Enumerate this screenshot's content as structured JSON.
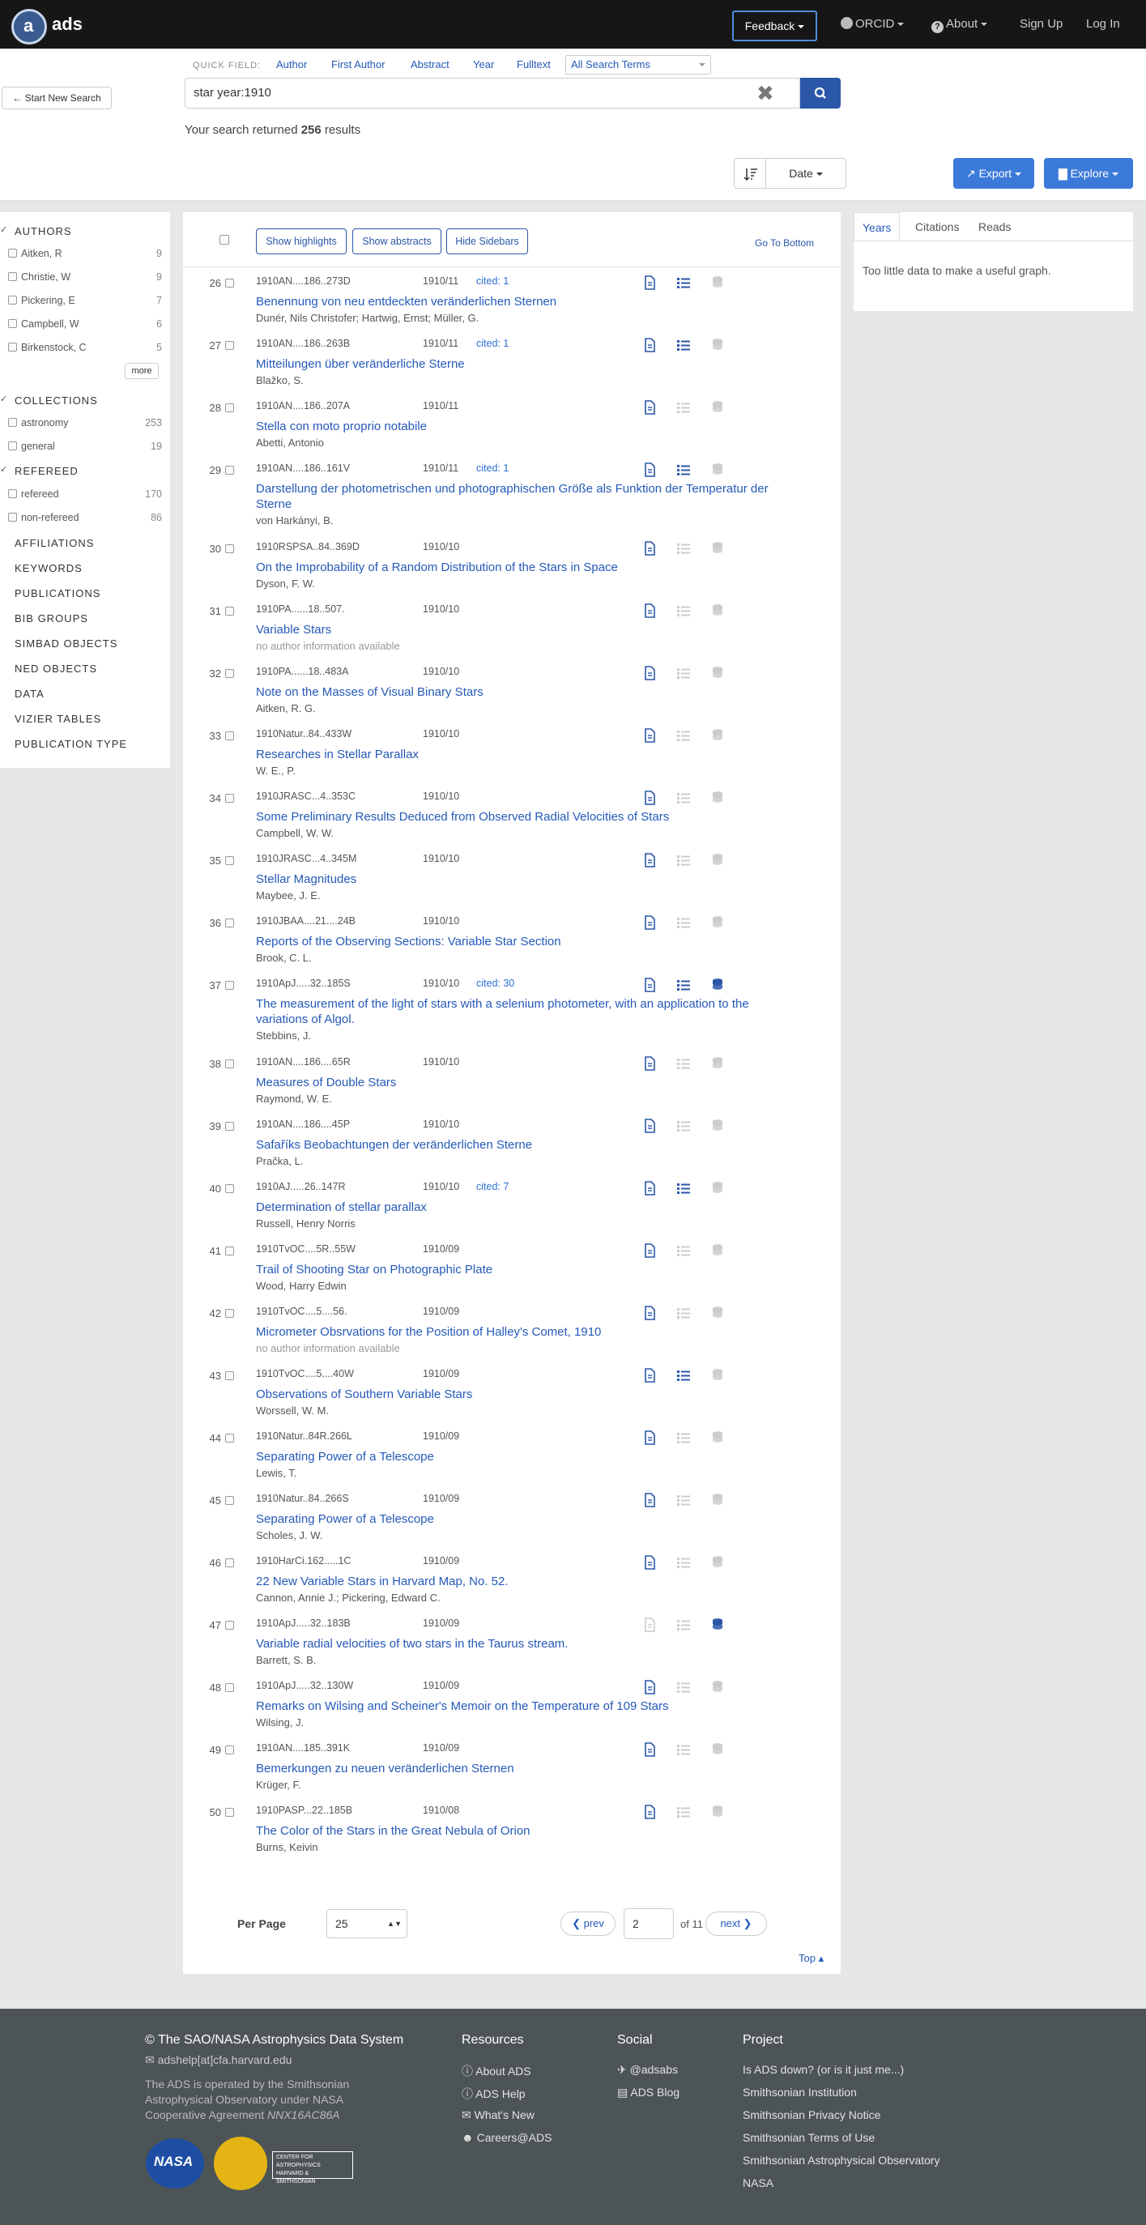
{
  "nav": {
    "logo_letter": "a",
    "logo_text": "ads",
    "feedback": "Feedback",
    "orcid": "ORCID",
    "about": "About",
    "signup": "Sign Up",
    "login": "Log In"
  },
  "search": {
    "start_new": "Start New Search",
    "quick_field_label": "QUICK FIELD:",
    "quick_fields": [
      "Author",
      "First Author",
      "Abstract",
      "Year",
      "Fulltext"
    ],
    "all_terms": "All Search Terms",
    "query": "star year:1910",
    "results_pre": "Your search returned ",
    "results_count": "256",
    "results_post": " results"
  },
  "toolbar": {
    "sort": "Date",
    "export": "Export",
    "explore": "Explore"
  },
  "facets": {
    "authors_head": "AUTHORS",
    "authors": [
      {
        "name": "Aitken, R",
        "count": "9"
      },
      {
        "name": "Christie, W",
        "count": "9"
      },
      {
        "name": "Pickering, E",
        "count": "7"
      },
      {
        "name": "Campbell, W",
        "count": "6"
      },
      {
        "name": "Birkenstock, C",
        "count": "5"
      }
    ],
    "more": "more",
    "collections_head": "COLLECTIONS",
    "collections": [
      {
        "name": "astronomy",
        "count": "253"
      },
      {
        "name": "general",
        "count": "19"
      }
    ],
    "refereed_head": "REFEREED",
    "refereed": [
      {
        "name": "refereed",
        "count": "170"
      },
      {
        "name": "non-refereed",
        "count": "86"
      }
    ],
    "other": [
      "AFFILIATIONS",
      "KEYWORDS",
      "PUBLICATIONS",
      "BIB GROUPS",
      "SIMBAD OBJECTS",
      "NED OBJECTS",
      "DATA",
      "VIZIER TABLES",
      "PUBLICATION TYPE"
    ]
  },
  "results_header": {
    "highlights": "Show highlights",
    "abstracts": "Show abstracts",
    "sidebars": "Hide Sidebars",
    "go_bottom": "Go To Bottom"
  },
  "results": [
    {
      "n": "26",
      "bib": "1910AN....186..273D",
      "date": "1910/11",
      "cited": "cited: 1",
      "title": "Benennung von neu entdeckten veränderlichen Sternen",
      "authors": "Dunér, Nils Christofer;  Hartwig, Ernst;  Müller, G.",
      "list": true,
      "db": false
    },
    {
      "n": "27",
      "bib": "1910AN....186..263B",
      "date": "1910/11",
      "cited": "cited: 1",
      "title": "Mitteilungen über veränderliche Sterne",
      "authors": "Blažko, S.",
      "list": true,
      "db": false
    },
    {
      "n": "28",
      "bib": "1910AN....186..207A",
      "date": "1910/11",
      "cited": "",
      "title": "Stella con moto proprio notabile",
      "authors": "Abetti, Antonio",
      "list": false,
      "db": false
    },
    {
      "n": "29",
      "bib": "1910AN....186..161V",
      "date": "1910/11",
      "cited": "cited: 1",
      "title": "Darstellung der photometrischen und photographischen Größe als Funktion der Temperatur der Sterne",
      "authors": "von Harkányi, B.",
      "list": true,
      "db": false
    },
    {
      "n": "30",
      "bib": "1910RSPSA..84..369D",
      "date": "1910/10",
      "cited": "",
      "title": "On the Improbability of a Random Distribution of the Stars in Space",
      "authors": "Dyson, F. W.",
      "list": false,
      "db": false
    },
    {
      "n": "31",
      "bib": "1910PA......18..507.",
      "date": "1910/10",
      "cited": "",
      "title": "Variable Stars",
      "authors": "no author information available",
      "list": false,
      "db": false
    },
    {
      "n": "32",
      "bib": "1910PA......18..483A",
      "date": "1910/10",
      "cited": "",
      "title": "Note on the Masses of Visual Binary Stars",
      "authors": "Aitken, R. G.",
      "list": false,
      "db": false
    },
    {
      "n": "33",
      "bib": "1910Natur..84..433W",
      "date": "1910/10",
      "cited": "",
      "title": "Researches in Stellar Parallax",
      "authors": "W. E., P.",
      "list": false,
      "db": false
    },
    {
      "n": "34",
      "bib": "1910JRASC...4..353C",
      "date": "1910/10",
      "cited": "",
      "title": "Some Preliminary Results Deduced from Observed Radial Velocities of Stars",
      "authors": "Campbell, W. W.",
      "list": false,
      "db": false
    },
    {
      "n": "35",
      "bib": "1910JRASC...4..345M",
      "date": "1910/10",
      "cited": "",
      "title": "Stellar Magnitudes",
      "authors": "Maybee, J. E.",
      "list": false,
      "db": false
    },
    {
      "n": "36",
      "bib": "1910JBAA....21....24B",
      "date": "1910/10",
      "cited": "",
      "title": "Reports of the Observing Sections: Variable Star Section",
      "authors": "Brook, C. L.",
      "list": false,
      "db": false
    },
    {
      "n": "37",
      "bib": "1910ApJ.....32..185S",
      "date": "1910/10",
      "cited": "cited: 30",
      "title": "The measurement of the light of stars with a selenium photometer, with an application to the variations of Algol.",
      "authors": "Stebbins, J.",
      "list": true,
      "db": true
    },
    {
      "n": "38",
      "bib": "1910AN....186....65R",
      "date": "1910/10",
      "cited": "",
      "title": "Measures of Double Stars",
      "authors": "Raymond, W. E.",
      "list": false,
      "db": false
    },
    {
      "n": "39",
      "bib": "1910AN....186....45P",
      "date": "1910/10",
      "cited": "",
      "title": "Safaříks Beobachtungen der veränderlichen Sterne",
      "authors": "Pračka, L.",
      "list": false,
      "db": false
    },
    {
      "n": "40",
      "bib": "1910AJ.....26..147R",
      "date": "1910/10",
      "cited": "cited: 7",
      "title": "Determination of stellar parallax",
      "authors": "Russell, Henry Norris",
      "list": true,
      "db": false
    },
    {
      "n": "41",
      "bib": "1910TvOC....5R..55W",
      "date": "1910/09",
      "cited": "",
      "title": "Trail of Shooting Star on Photographic Plate",
      "authors": "Wood, Harry Edwin",
      "list": false,
      "db": false
    },
    {
      "n": "42",
      "bib": "1910TvOC....5....56.",
      "date": "1910/09",
      "cited": "",
      "title": "Micrometer Obsrvations for the Position of Halley's Comet, 1910",
      "authors": "no author information available",
      "list": false,
      "db": false
    },
    {
      "n": "43",
      "bib": "1910TvOC....5....40W",
      "date": "1910/09",
      "cited": "",
      "title": "Observations of Southern Variable Stars",
      "authors": "Worssell, W. M.",
      "list": true,
      "db": false
    },
    {
      "n": "44",
      "bib": "1910Natur..84R.266L",
      "date": "1910/09",
      "cited": "",
      "title": "Separating Power of a Telescope",
      "authors": "Lewis, T.",
      "list": false,
      "db": false
    },
    {
      "n": "45",
      "bib": "1910Natur..84..266S",
      "date": "1910/09",
      "cited": "",
      "title": "Separating Power of a Telescope",
      "authors": "Scholes, J. W.",
      "list": false,
      "db": false
    },
    {
      "n": "46",
      "bib": "1910HarCi.162.....1C",
      "date": "1910/09",
      "cited": "",
      "title": "22 New Variable Stars in Harvard Map, No. 52.",
      "authors": "Cannon, Annie J.;  Pickering, Edward C.",
      "list": false,
      "db": false
    },
    {
      "n": "47",
      "bib": "1910ApJ.....32..183B",
      "date": "1910/09",
      "cited": "",
      "title": "Variable radial velocities of two stars in the Taurus stream.",
      "authors": "Barrett, S. B.",
      "list": false,
      "db": true,
      "nodoc": true
    },
    {
      "n": "48",
      "bib": "1910ApJ.....32..130W",
      "date": "1910/09",
      "cited": "",
      "title": "Remarks on Wilsing and Scheiner's Memoir on the Temperature of 109 Stars",
      "authors": "Wilsing, J.",
      "list": false,
      "db": false
    },
    {
      "n": "49",
      "bib": "1910AN....185..391K",
      "date": "1910/09",
      "cited": "",
      "title": "Bemerkungen zu neuen veränderlichen Sternen",
      "authors": "Krüger, F.",
      "list": false,
      "db": false
    },
    {
      "n": "50",
      "bib": "1910PASP...22..185B",
      "date": "1910/08",
      "cited": "",
      "title": "The Color of the Stars in the Great Nebula of Orion",
      "authors": "Burns, Keivin",
      "list": false,
      "db": false
    }
  ],
  "pager": {
    "per_page_label": "Per Page",
    "per_page": "25",
    "prev": "prev",
    "page": "2",
    "of": "of 11",
    "next": "next",
    "top": "Top"
  },
  "graph": {
    "tabs": [
      "Years",
      "Citations",
      "Reads"
    ],
    "message": "Too little data to make a useful graph."
  },
  "footer": {
    "title": "© The SAO/NASA Astrophysics Data System",
    "email": "adshelp[at]cfa.harvard.edu",
    "operated": "The ADS is operated by the Smithsonian Astrophysical Observatory under NASA Cooperative Agreement ",
    "agreement": "NNX16AC86A",
    "nasa_logo": "NASA",
    "cfa_logo": "CENTER FOR ASTROPHYSICS HARVARD & SMITHSONIAN",
    "resources_head": "Resources",
    "resources": [
      "About ADS",
      "ADS Help",
      "What's New",
      "Careers@ADS"
    ],
    "social_head": "Social",
    "social": [
      "@adsabs",
      "ADS Blog"
    ],
    "project_head": "Project",
    "project": [
      "Is ADS down? (or is it just me...)",
      "Smithsonian Institution",
      "Smithsonian Privacy Notice",
      "Smithsonian Terms of Use",
      "Smithsonian Astrophysical Observatory",
      "NASA"
    ]
  }
}
